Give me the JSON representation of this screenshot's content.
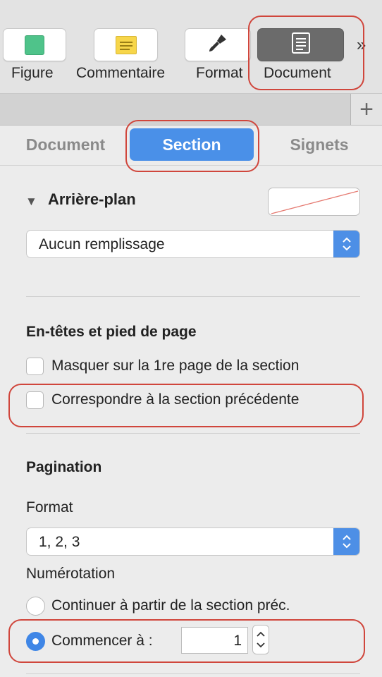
{
  "toolbar": {
    "buttons": [
      {
        "label": "Figure",
        "icon": "figure-square-icon"
      },
      {
        "label": "Commentaire",
        "icon": "comment-note-icon"
      },
      {
        "label": "Format",
        "icon": "format-paintbrush-icon"
      },
      {
        "label": "Document",
        "icon": "document-icon",
        "active": true
      }
    ],
    "overflow_glyph": "»",
    "add_glyph": "+"
  },
  "tabs": [
    "Document",
    "Section",
    "Signets"
  ],
  "active_tab": "Section",
  "background_section": {
    "title": "Arrière-plan",
    "fill_select": "Aucun remplissage"
  },
  "headers_footers": {
    "title": "En-têtes et pied de page",
    "options": [
      {
        "label": "Masquer sur la 1re page de la section",
        "checked": false
      },
      {
        "label": "Correspondre à la section précédente",
        "checked": false
      }
    ]
  },
  "pagination": {
    "title": "Pagination",
    "format_label": "Format",
    "format_value": "1, 2, 3",
    "numbering_label": "Numérotation",
    "radio_continue": "Continuer à partir de la section préc.",
    "radio_start": "Commencer à :",
    "start_value": "1"
  },
  "colors": {
    "accent": "#4a90e8",
    "highlight": "#d0463c"
  }
}
